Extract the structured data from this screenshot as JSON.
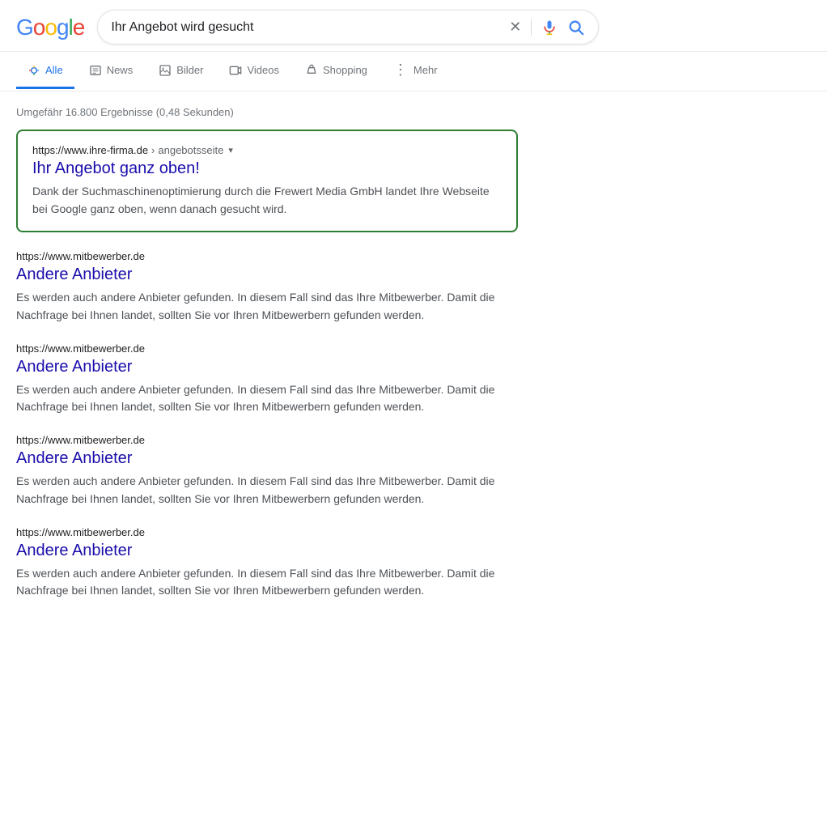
{
  "header": {
    "logo": {
      "letters": [
        {
          "char": "G",
          "color": "#4285F4"
        },
        {
          "char": "o",
          "color": "#EA4335"
        },
        {
          "char": "o",
          "color": "#FBBC05"
        },
        {
          "char": "g",
          "color": "#4285F4"
        },
        {
          "char": "l",
          "color": "#34A853"
        },
        {
          "char": "e",
          "color": "#EA4335"
        }
      ]
    },
    "search_query": "Ihr Angebot wird gesucht",
    "clear_button_label": "×",
    "search_button_label": "Suchen"
  },
  "nav": {
    "tabs": [
      {
        "id": "alle",
        "label": "Alle",
        "active": true
      },
      {
        "id": "news",
        "label": "News",
        "active": false
      },
      {
        "id": "bilder",
        "label": "Bilder",
        "active": false
      },
      {
        "id": "videos",
        "label": "Videos",
        "active": false
      },
      {
        "id": "shopping",
        "label": "Shopping",
        "active": false
      },
      {
        "id": "mehr",
        "label": "Mehr",
        "active": false
      }
    ]
  },
  "results": {
    "count_text": "Umgefähr 16.800 Ergebnisse (0,48 Sekunden)",
    "featured": {
      "url_domain": "https://www.ihre-firma.de",
      "url_path": "angebotsseite",
      "title": "Ihr Angebot ganz oben!",
      "description": "Dank der Suchmaschinenoptimierung durch die Frewert Media GmbH landet Ihre Webseite bei Google ganz oben, wenn danach gesucht wird."
    },
    "items": [
      {
        "url": "https://www.mitbewerber.de",
        "title": "Andere Anbieter",
        "description": "Es werden auch andere Anbieter gefunden. In diesem Fall sind das Ihre Mitbewerber. Damit die Nachfrage bei Ihnen landet, sollten Sie vor Ihren Mitbewerbern gefunden werden."
      },
      {
        "url": "https://www.mitbewerber.de",
        "title": "Andere Anbieter",
        "description": "Es werden auch andere Anbieter gefunden. In diesem Fall sind das Ihre Mitbewerber. Damit die Nachfrage bei Ihnen landet, sollten Sie vor Ihren Mitbewerbern gefunden werden."
      },
      {
        "url": "https://www.mitbewerber.de",
        "title": "Andere Anbieter",
        "description": "Es werden auch andere Anbieter gefunden. In diesem Fall sind das Ihre Mitbewerber. Damit die Nachfrage bei Ihnen landet, sollten Sie vor Ihren Mitbewerbern gefunden werden."
      },
      {
        "url": "https://www.mitbewerber.de",
        "title": "Andere Anbieter",
        "description": "Es werden auch andere Anbieter gefunden. In diesem Fall sind das Ihre Mitbewerber. Damit die Nachfrage bei Ihnen landet, sollten Sie vor Ihren Mitbewerbern gefunden werden."
      }
    ]
  },
  "icons": {
    "search": "🔍",
    "news": "📰",
    "images": "🖼",
    "videos": "▶",
    "shopping": "🏷",
    "more": "⋮"
  },
  "colors": {
    "google_blue": "#4285F4",
    "google_red": "#EA4335",
    "google_yellow": "#FBBC05",
    "google_green": "#34A853",
    "featured_border": "#2e7d32",
    "link_color": "#1a0dab",
    "active_tab": "#1a73e8"
  }
}
